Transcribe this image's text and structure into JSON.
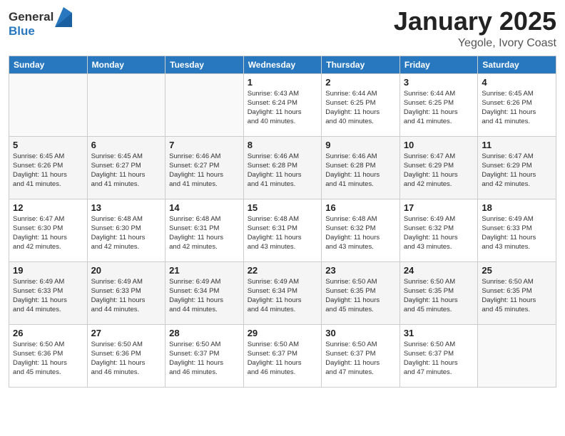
{
  "logo": {
    "general": "General",
    "blue": "Blue"
  },
  "title": {
    "month_year": "January 2025",
    "location": "Yegole, Ivory Coast"
  },
  "weekdays": [
    "Sunday",
    "Monday",
    "Tuesday",
    "Wednesday",
    "Thursday",
    "Friday",
    "Saturday"
  ],
  "weeks": [
    [
      {
        "day": "",
        "info": ""
      },
      {
        "day": "",
        "info": ""
      },
      {
        "day": "",
        "info": ""
      },
      {
        "day": "1",
        "info": "Sunrise: 6:43 AM\nSunset: 6:24 PM\nDaylight: 11 hours\nand 40 minutes."
      },
      {
        "day": "2",
        "info": "Sunrise: 6:44 AM\nSunset: 6:25 PM\nDaylight: 11 hours\nand 40 minutes."
      },
      {
        "day": "3",
        "info": "Sunrise: 6:44 AM\nSunset: 6:25 PM\nDaylight: 11 hours\nand 41 minutes."
      },
      {
        "day": "4",
        "info": "Sunrise: 6:45 AM\nSunset: 6:26 PM\nDaylight: 11 hours\nand 41 minutes."
      }
    ],
    [
      {
        "day": "5",
        "info": "Sunrise: 6:45 AM\nSunset: 6:26 PM\nDaylight: 11 hours\nand 41 minutes."
      },
      {
        "day": "6",
        "info": "Sunrise: 6:45 AM\nSunset: 6:27 PM\nDaylight: 11 hours\nand 41 minutes."
      },
      {
        "day": "7",
        "info": "Sunrise: 6:46 AM\nSunset: 6:27 PM\nDaylight: 11 hours\nand 41 minutes."
      },
      {
        "day": "8",
        "info": "Sunrise: 6:46 AM\nSunset: 6:28 PM\nDaylight: 11 hours\nand 41 minutes."
      },
      {
        "day": "9",
        "info": "Sunrise: 6:46 AM\nSunset: 6:28 PM\nDaylight: 11 hours\nand 41 minutes."
      },
      {
        "day": "10",
        "info": "Sunrise: 6:47 AM\nSunset: 6:29 PM\nDaylight: 11 hours\nand 42 minutes."
      },
      {
        "day": "11",
        "info": "Sunrise: 6:47 AM\nSunset: 6:29 PM\nDaylight: 11 hours\nand 42 minutes."
      }
    ],
    [
      {
        "day": "12",
        "info": "Sunrise: 6:47 AM\nSunset: 6:30 PM\nDaylight: 11 hours\nand 42 minutes."
      },
      {
        "day": "13",
        "info": "Sunrise: 6:48 AM\nSunset: 6:30 PM\nDaylight: 11 hours\nand 42 minutes."
      },
      {
        "day": "14",
        "info": "Sunrise: 6:48 AM\nSunset: 6:31 PM\nDaylight: 11 hours\nand 42 minutes."
      },
      {
        "day": "15",
        "info": "Sunrise: 6:48 AM\nSunset: 6:31 PM\nDaylight: 11 hours\nand 43 minutes."
      },
      {
        "day": "16",
        "info": "Sunrise: 6:48 AM\nSunset: 6:32 PM\nDaylight: 11 hours\nand 43 minutes."
      },
      {
        "day": "17",
        "info": "Sunrise: 6:49 AM\nSunset: 6:32 PM\nDaylight: 11 hours\nand 43 minutes."
      },
      {
        "day": "18",
        "info": "Sunrise: 6:49 AM\nSunset: 6:33 PM\nDaylight: 11 hours\nand 43 minutes."
      }
    ],
    [
      {
        "day": "19",
        "info": "Sunrise: 6:49 AM\nSunset: 6:33 PM\nDaylight: 11 hours\nand 44 minutes."
      },
      {
        "day": "20",
        "info": "Sunrise: 6:49 AM\nSunset: 6:33 PM\nDaylight: 11 hours\nand 44 minutes."
      },
      {
        "day": "21",
        "info": "Sunrise: 6:49 AM\nSunset: 6:34 PM\nDaylight: 11 hours\nand 44 minutes."
      },
      {
        "day": "22",
        "info": "Sunrise: 6:49 AM\nSunset: 6:34 PM\nDaylight: 11 hours\nand 44 minutes."
      },
      {
        "day": "23",
        "info": "Sunrise: 6:50 AM\nSunset: 6:35 PM\nDaylight: 11 hours\nand 45 minutes."
      },
      {
        "day": "24",
        "info": "Sunrise: 6:50 AM\nSunset: 6:35 PM\nDaylight: 11 hours\nand 45 minutes."
      },
      {
        "day": "25",
        "info": "Sunrise: 6:50 AM\nSunset: 6:35 PM\nDaylight: 11 hours\nand 45 minutes."
      }
    ],
    [
      {
        "day": "26",
        "info": "Sunrise: 6:50 AM\nSunset: 6:36 PM\nDaylight: 11 hours\nand 45 minutes."
      },
      {
        "day": "27",
        "info": "Sunrise: 6:50 AM\nSunset: 6:36 PM\nDaylight: 11 hours\nand 46 minutes."
      },
      {
        "day": "28",
        "info": "Sunrise: 6:50 AM\nSunset: 6:37 PM\nDaylight: 11 hours\nand 46 minutes."
      },
      {
        "day": "29",
        "info": "Sunrise: 6:50 AM\nSunset: 6:37 PM\nDaylight: 11 hours\nand 46 minutes."
      },
      {
        "day": "30",
        "info": "Sunrise: 6:50 AM\nSunset: 6:37 PM\nDaylight: 11 hours\nand 47 minutes."
      },
      {
        "day": "31",
        "info": "Sunrise: 6:50 AM\nSunset: 6:37 PM\nDaylight: 11 hours\nand 47 minutes."
      },
      {
        "day": "",
        "info": ""
      }
    ]
  ]
}
